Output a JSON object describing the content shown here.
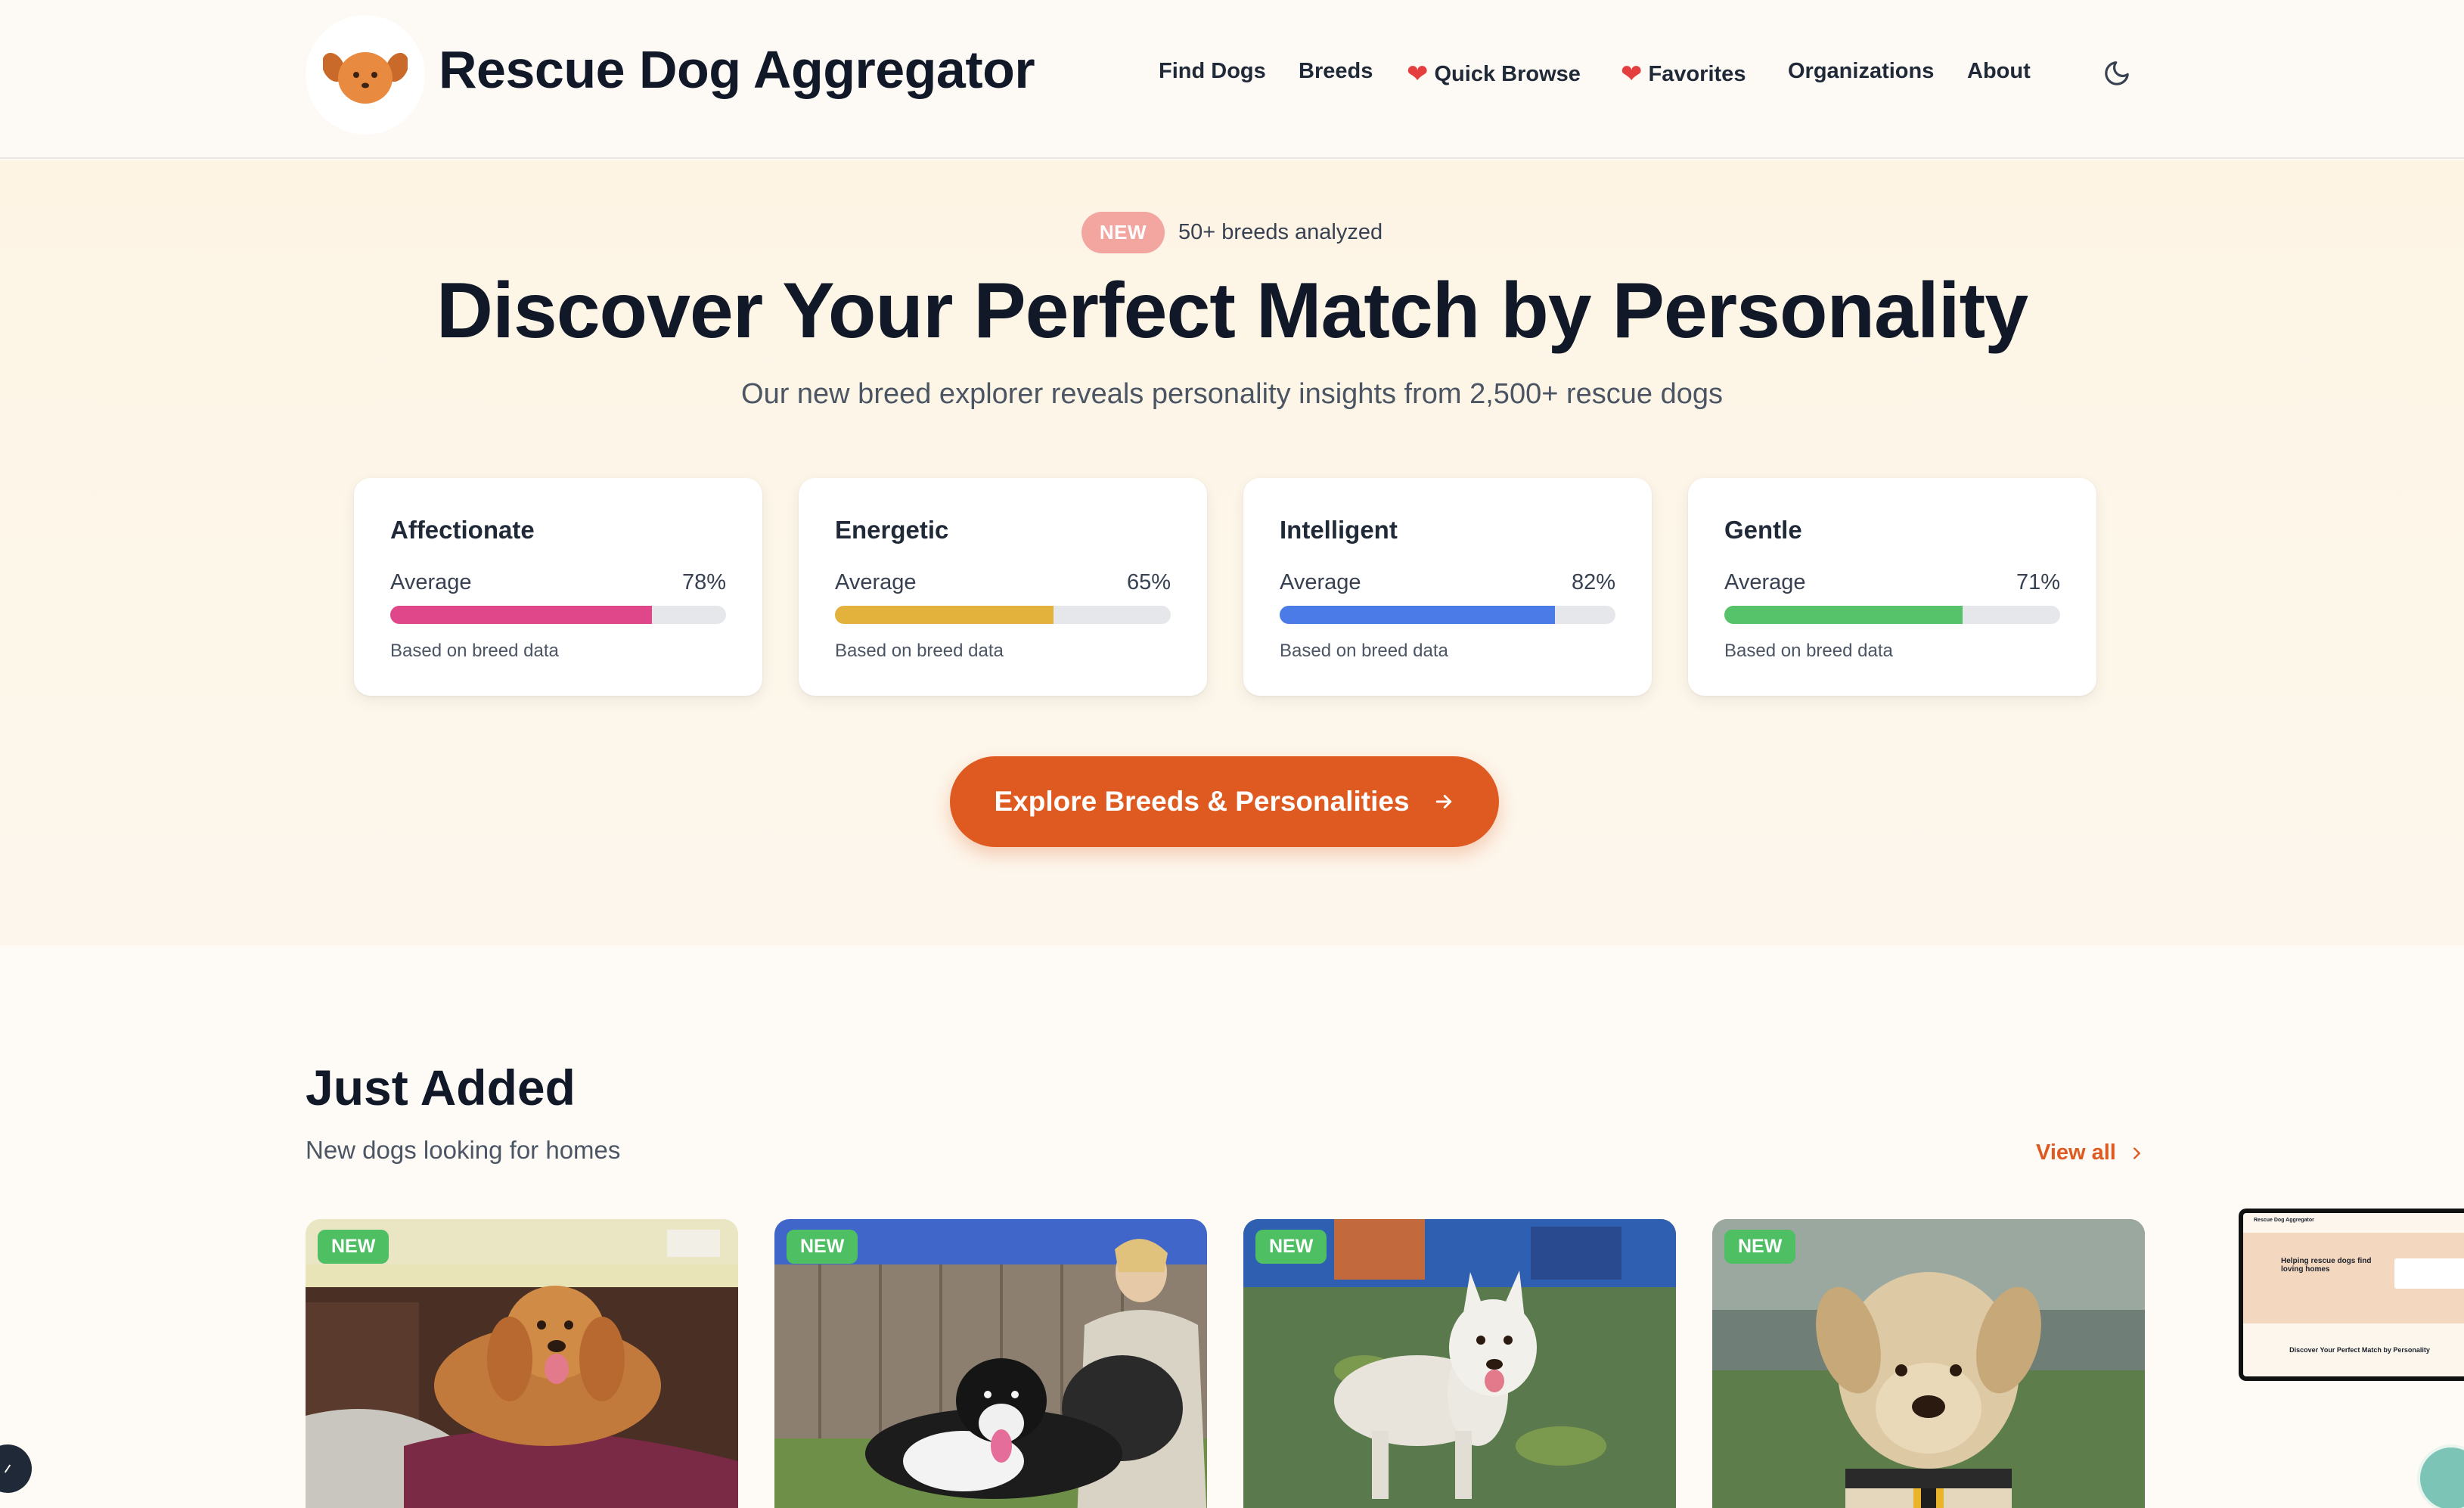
{
  "header": {
    "brand": "Rescue Dog Aggregator",
    "nav": [
      {
        "label": "Find Dogs",
        "heart": false
      },
      {
        "label": "Breeds",
        "heart": false
      },
      {
        "label": "Quick Browse",
        "heart": true
      },
      {
        "label": "Favorites",
        "heart": true
      },
      {
        "label": "Organizations",
        "heart": false
      },
      {
        "label": "About",
        "heart": false
      }
    ],
    "theme_toggle_icon": "moon-icon"
  },
  "hero": {
    "badge": "NEW",
    "badge_text": "50+ breeds analyzed",
    "title": "Discover Your Perfect Match by Personality",
    "subtitle": "Our new breed explorer reveals personality insights from 2,500+ rescue dogs",
    "traits": [
      {
        "name": "Affectionate",
        "label": "Average",
        "percent_text": "78%",
        "value": 78,
        "color": "#e0478a",
        "note": "Based on breed data"
      },
      {
        "name": "Energetic",
        "label": "Average",
        "percent_text": "65%",
        "value": 65,
        "color": "#e3b23c",
        "note": "Based on breed data"
      },
      {
        "name": "Intelligent",
        "label": "Average",
        "percent_text": "82%",
        "value": 82,
        "color": "#4a7be6",
        "note": "Based on breed data"
      },
      {
        "name": "Gentle",
        "label": "Average",
        "percent_text": "71%",
        "value": 71,
        "color": "#56c26a",
        "note": "Based on breed data"
      }
    ],
    "cta": "Explore Breeds & Personalities",
    "cta_icon": "arrow-right-icon"
  },
  "just_added": {
    "title": "Just Added",
    "subtitle": "New dogs looking for homes",
    "view_all": "View all",
    "cards": [
      {
        "tag": "NEW",
        "photo": "cocker-spaniel-on-sofa"
      },
      {
        "tag": "NEW",
        "photo": "black-white-dog-with-woman"
      },
      {
        "tag": "NEW",
        "photo": "white-shepherd-on-grass"
      },
      {
        "tag": "NEW",
        "photo": "yellow-lab-close-up"
      }
    ]
  },
  "preview": {
    "brand": "Rescue Dog Aggregator",
    "headline": "Helping rescue dogs find loving homes",
    "footer_title": "Discover Your Perfect Match by Personality"
  }
}
